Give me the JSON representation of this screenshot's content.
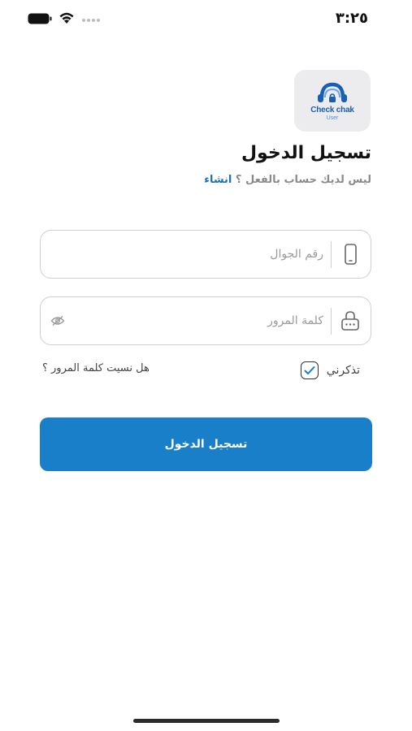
{
  "status_bar": {
    "time": "٣:٢٥"
  },
  "logo": {
    "name": "Check chak",
    "subtitle": "User"
  },
  "login": {
    "title": "تسجيل الدخول",
    "no_account_prompt": "ليس لديك حساب بالفعل ؟",
    "signup_link": "انشاء",
    "phone_placeholder": "رقم الجوال",
    "password_placeholder": "كلمة المرور",
    "remember_me_label": "تذكرني",
    "remember_me_checked": true,
    "forgot_password_link": "هل نسيت كلمة المرور ؟",
    "submit_label": "تسجيل الدخول"
  },
  "colors": {
    "primary": "#1a7fc9",
    "link": "#1a73b9",
    "logo_blue": "#1a5fb4"
  }
}
